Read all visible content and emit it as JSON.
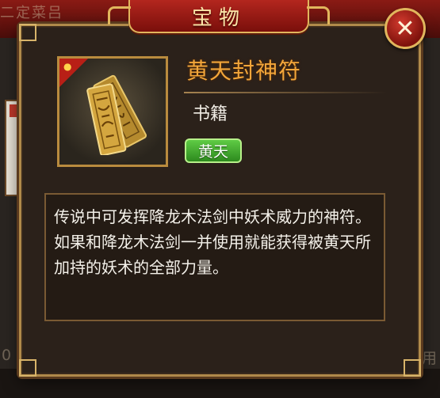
{
  "background": {
    "top_fragment": "二定菜吕",
    "bottom_left_fragment": "0",
    "bottom_right_fragment": "通用"
  },
  "dialog": {
    "title": "宝物",
    "close_label": "✕"
  },
  "item": {
    "name": "黄天封神符",
    "category": "书籍",
    "tag": "黄天",
    "description": "传说中可发挥降龙木法剑中妖术威力的神符。如果和降龙木法剑一并使用就能获得被黄天所加持的妖术的全部力量。",
    "icon": "talisman-icon",
    "ribbon_icon": "person-icon"
  },
  "colors": {
    "title_banner": "#b3261e",
    "item_name": "#f2a63a",
    "tag_bg": "#4fb338",
    "frame_border": "#b08a4a"
  }
}
